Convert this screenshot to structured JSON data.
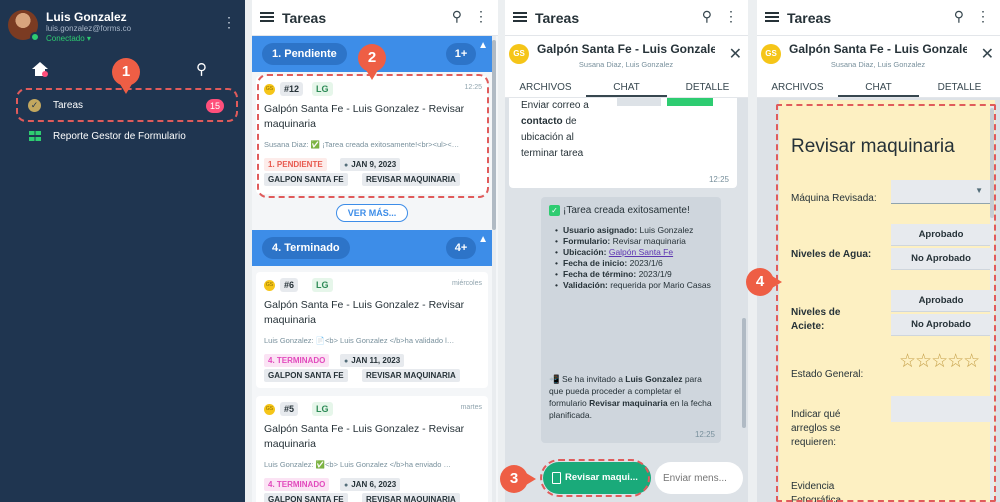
{
  "sidebar": {
    "user_name": "Luis Gonzalez",
    "user_email": "luis.gonzalez@forms.co",
    "status": "Conectado ▾",
    "items": [
      {
        "label": "Tareas",
        "badge": "15"
      },
      {
        "label": "Reporte Gestor de Formulario"
      }
    ]
  },
  "list_panel": {
    "title": "Tareas",
    "groups": [
      {
        "label": "1. Pendiente",
        "count": "1+"
      },
      {
        "label": "4. Terminado",
        "count": "4+"
      }
    ],
    "see_more": "VER MÁS...",
    "cards": [
      {
        "num": "#12",
        "initials": "LG",
        "time": "12:25",
        "title": "Galpón Santa Fe - Luis Gonzalez - Revisar maquinaria",
        "preview": "Susana Diaz: ✅ ¡Tarea creada exitosamente!<br><ul><…",
        "state": "1. PENDIENTE",
        "date": "JAN 9, 2023",
        "tag1": "GALPON SANTA FE",
        "tag2": "REVISAR MAQUINARIA"
      },
      {
        "num": "#6",
        "initials": "LG",
        "time": "miércoles",
        "title": "Galpón Santa Fe - Luis Gonzalez - Revisar maquinaria",
        "preview": "Luis Gonzalez: 📄<b> Luis Gonzalez </b>ha validado l…",
        "state": "4. TERMINADO",
        "date": "JAN 11, 2023",
        "tag1": "GALPON SANTA FE",
        "tag2": "REVISAR MAQUINARIA"
      },
      {
        "num": "#5",
        "initials": "LG",
        "time": "martes",
        "title": "Galpón Santa Fe - Luis Gonzalez - Revisar maquinaria",
        "preview": "Luis Gonzalez: ✅<b> Luis Gonzalez </b>ha enviado …",
        "state": "4. TERMINADO",
        "date": "JAN 6, 2023",
        "tag1": "GALPON SANTA FE",
        "tag2": "REVISAR MAQUINARIA"
      }
    ]
  },
  "chat": {
    "app_title": "Tareas",
    "avatar": "GS",
    "title": "Galpón Santa Fe - Luis Gonzalez - Revisar maquinaria",
    "subtitle": "Susana Diaz, Luis Gonzalez",
    "tabs": [
      "ARCHIVOS",
      "CHAT",
      "DETALLE"
    ],
    "msg_top_lines": [
      "Enviar correo a",
      "contacto de",
      "ubicación al",
      "terminar tarea"
    ],
    "msg_top_bold": "contacto",
    "msg_top_after": " de",
    "msg_top_time": "12:25",
    "task_created": "¡Tarea creada exitosamente!",
    "fields": [
      {
        "k": "Usuario asignado:",
        "v": " Luis Gonzalez"
      },
      {
        "k": "Formulario:",
        "v": "  Revisar maquinaria"
      },
      {
        "k": "Ubicación:",
        "v": " ",
        "link": "Galpón Santa Fe"
      },
      {
        "k": "Fecha de inicio:",
        "v": " 2023/1/6"
      },
      {
        "k": "Fecha de término:",
        "v": " 2023/1/9"
      },
      {
        "k": "Validación:",
        "v": " requerida por Mario Casas"
      }
    ],
    "invite_pre": "Se ha invitado a ",
    "invite_name": "Luis Gonzalez",
    "invite_mid": " para que pueda proceder a completar el formulario  ",
    "invite_form": "Revisar maquinaria",
    "invite_post": "  en la fecha planificada.",
    "msg_card_time": "12:25",
    "form_button": "Revisar maqui...",
    "input_placeholder": "Enviar mens..."
  },
  "form": {
    "title": "Revisar maquinaria",
    "labels": {
      "maquina": "Máquina Revisada:",
      "agua": "Niveles de Agua:",
      "aceite": "Niveles de Aciete:",
      "estado": "Estado General:",
      "arreglos": "Indicar qué arreglos se requieren:",
      "evidencia": "Evidencia Fotográfica"
    },
    "aprobado": "Aprobado",
    "no_aprobado": "No Aprobado",
    "stars": "☆☆☆☆☆"
  },
  "annotations": [
    "1",
    "2",
    "3",
    "4"
  ],
  "colors": {
    "sidebar": "#1f3550",
    "accent": "#3d8de8",
    "annotation": "#ee5e45",
    "form_bg": "#fdf0c2"
  }
}
